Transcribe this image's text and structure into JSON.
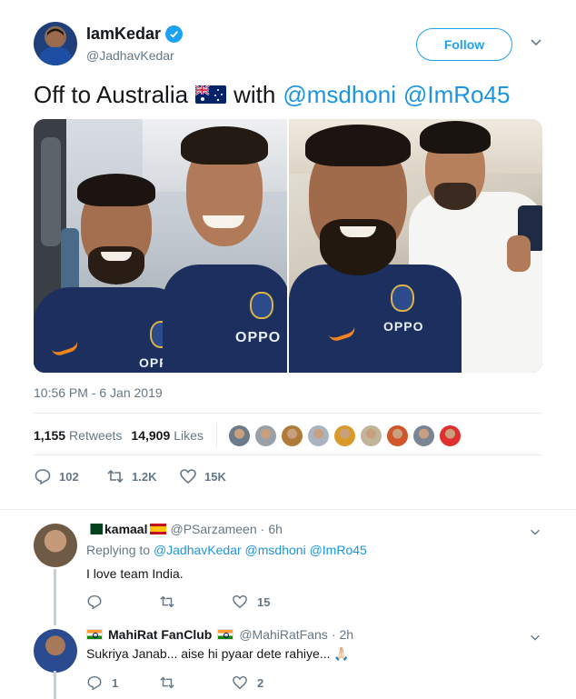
{
  "tweet": {
    "author": {
      "display_name": "IamKedar",
      "handle": "@JadhavKedar",
      "verified": true
    },
    "follow_label": "Follow",
    "text": {
      "prefix": "Off to Australia",
      "with": "with",
      "mentions": [
        "@msdhoni",
        "@ImRo45"
      ],
      "flag_icon": "australia-flag-icon"
    },
    "timestamp": "10:56 PM - 6 Jan 2019",
    "stats": {
      "retweets_count": "1,155",
      "retweets_label": "Retweets",
      "likes_count": "14,909",
      "likes_label": "Likes",
      "liker_avatars": [
        "#6c7a8a",
        "#9aa0a8",
        "#b07a3a",
        "#aab4c0",
        "#d89a2a",
        "#c0b49a",
        "#d0552a",
        "#7a8694",
        "#e03030"
      ]
    },
    "actions": {
      "replies": "102",
      "retweets": "1.2K",
      "likes": "15K"
    },
    "media_logo": "OPPO"
  },
  "replies": [
    {
      "display_name": "kamaal",
      "handle": "@PSarzameen",
      "time": "6h",
      "replying_label": "Replying to",
      "replying_to": [
        "@JadhavKedar",
        "@msdhoni",
        "@ImRo45"
      ],
      "text": "I love team India.",
      "actions": {
        "replies": "",
        "retweets": "",
        "likes": "15"
      }
    },
    {
      "display_name": "MahiRat FanClub",
      "handle": "@MahiRatFans",
      "time": "2h",
      "text": "Sukriya Janab... aise hi pyaar dete rahiye...",
      "emoji": "🙏🏻",
      "actions": {
        "replies": "1",
        "retweets": "",
        "likes": "2"
      }
    }
  ],
  "colors": {
    "accent": "#1da1f2",
    "mention": "#1b95e0",
    "muted": "#657786",
    "text": "#14171a"
  }
}
